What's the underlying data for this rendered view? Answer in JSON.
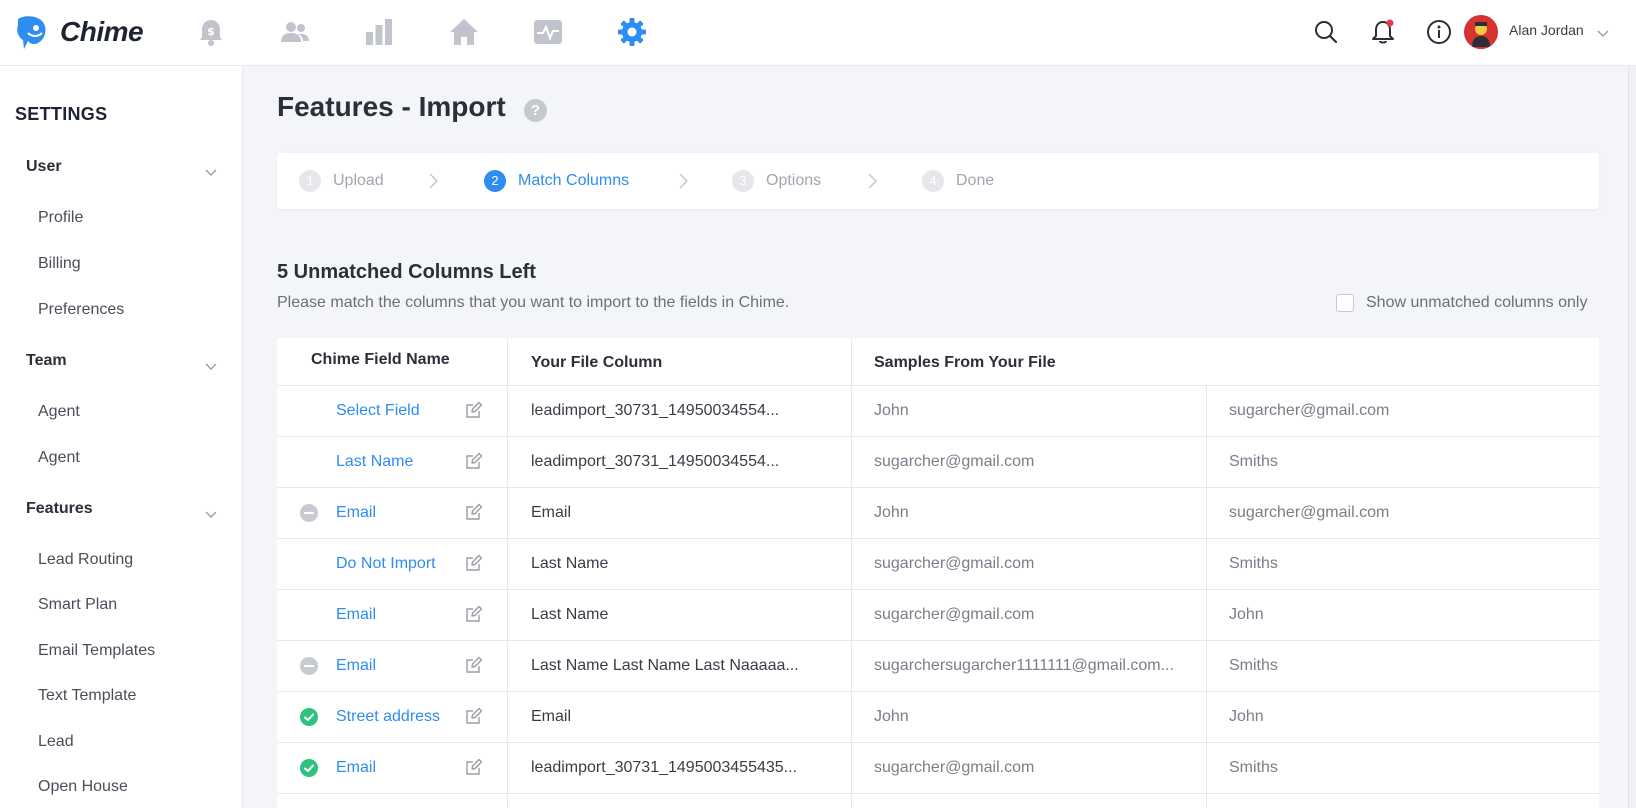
{
  "app": {
    "name": "Chime",
    "brand_color": "#2d8df0"
  },
  "topbar": {
    "nav_icons": [
      "dollar-bell-icon",
      "people-icon",
      "bar-chart-icon",
      "home-icon",
      "activity-icon",
      "gear-icon"
    ],
    "active_nav": "gear-icon",
    "right_icons": [
      "search-icon",
      "notification-bell-icon",
      "info-icon"
    ],
    "user": {
      "name": "Alan Jordan"
    }
  },
  "sidebar": {
    "title": "SETTINGS",
    "groups": [
      {
        "label": "User",
        "items": [
          "Profile",
          "Billing",
          "Preferences"
        ]
      },
      {
        "label": "Team",
        "items": [
          "Agent",
          "Agent"
        ]
      },
      {
        "label": "Features",
        "items": [
          "Lead Routing",
          "Smart Plan",
          "Email Templates",
          "Text Template",
          "Lead",
          "Open House"
        ]
      }
    ]
  },
  "page": {
    "title": "Features - Import",
    "help": "?"
  },
  "steps": [
    {
      "num": "1",
      "label": "Upload",
      "active": false
    },
    {
      "num": "2",
      "label": "Match Columns",
      "active": true
    },
    {
      "num": "3",
      "label": "Options",
      "active": false
    },
    {
      "num": "4",
      "label": "Done",
      "active": false
    }
  ],
  "unmatched": {
    "title": "5 Unmatched Columns Left",
    "description": "Please match the columns that you want to import to the fields in Chime.",
    "show_unmatched_label": "Show unmatched columns only",
    "show_unmatched_checked": false
  },
  "table": {
    "headers": [
      "Chime Field Name",
      "Your File Column",
      "Samples From Your File"
    ],
    "rows": [
      {
        "status": "none",
        "field": "Select Field",
        "file_column": "leadimport_30731_14950034554...",
        "sample1": "John",
        "sample2": "sugarcher@gmail.com"
      },
      {
        "status": "none",
        "field": "Last Name",
        "file_column": "leadimport_30731_14950034554...",
        "sample1": "sugarcher@gmail.com",
        "sample2": "Smiths"
      },
      {
        "status": "minus",
        "field": "Email",
        "file_column": "Email",
        "sample1": "John",
        "sample2": "sugarcher@gmail.com"
      },
      {
        "status": "none",
        "field": "Do Not Import",
        "file_column": "Last Name",
        "sample1": "sugarcher@gmail.com",
        "sample2": "Smiths"
      },
      {
        "status": "none",
        "field": "Email",
        "file_column": "Last Name",
        "sample1": "sugarcher@gmail.com",
        "sample2": "John"
      },
      {
        "status": "minus",
        "field": "Email",
        "file_column": "Last Name Last Name Last Naaaaa...",
        "sample1": "sugarchersugarcher1111111@gmail.com...",
        "sample2": "Smiths"
      },
      {
        "status": "check",
        "field": "Street address",
        "file_column": "Email",
        "sample1": "John",
        "sample2": "John"
      },
      {
        "status": "check",
        "field": "Email",
        "file_column": "leadimport_30731_1495003455435...",
        "sample1": "sugarcher@gmail.com",
        "sample2": "Smiths"
      }
    ]
  }
}
